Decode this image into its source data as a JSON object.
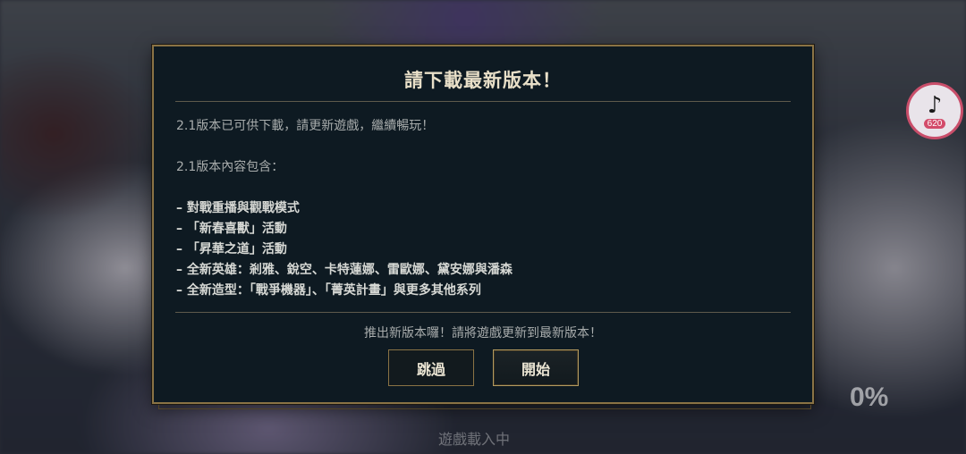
{
  "background": {
    "loading_percent": "0%",
    "loading_text": "遊戲載入中",
    "tiktok_badge": {
      "icon": "tiktok-icon",
      "count": "620",
      "ring_color": "#c94e6a"
    }
  },
  "dialog": {
    "title": "請下載最新版本！",
    "intro": "2.1版本已可供下載，請更新遊戲，繼續暢玩！",
    "contents_heading": "2.1版本內容包含：",
    "features": [
      "– 對戰重播與觀戰模式",
      "– 「新春喜獸」活動",
      "– 「昇華之道」活動",
      "– 全新英雄：剎雅、銳空、卡特蓮娜、雷歐娜、黛安娜與潘森",
      "– 全新造型：「戰爭機器」、「菁英計畫」與更多其他系列"
    ],
    "footer_note": "推出新版本囉！請將遊戲更新到最新版本！",
    "buttons": {
      "skip": "跳過",
      "start": "開始"
    },
    "colors": {
      "border": "#8a7345",
      "background": "#0e1a22",
      "title": "#e8dfc8"
    }
  }
}
